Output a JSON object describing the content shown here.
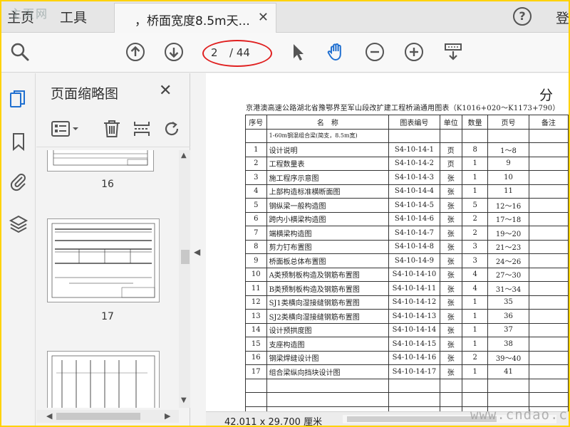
{
  "tabs": {
    "home": "主页",
    "tools": "工具",
    "doc_title": "，桥面宽度8.5m天...",
    "close": "✕",
    "help": "?",
    "login": "登"
  },
  "watermark_top": "主页网",
  "toolbar": {
    "page_current": "2",
    "page_total": "/ 44"
  },
  "thumbnails": {
    "title": "页面缩略图",
    "close": "✕",
    "pages": [
      "16",
      "17"
    ]
  },
  "document": {
    "corner": "分",
    "heading": "京港澳高速公路湖北省豫鄂界至军山段改扩建工程桥涵通用图表（K1016+020～K1173+790）",
    "headers": [
      "序号",
      "名　称",
      "图表编号",
      "单位",
      "数量",
      "页号",
      "备注"
    ],
    "subtitle": "1-60m钢混组合梁(简支，8.5m宽)",
    "rows": [
      {
        "no": "1",
        "name": "设计说明",
        "code": "S4-10-14-1",
        "unit": "页",
        "count": "8",
        "page": "1～8"
      },
      {
        "no": "2",
        "name": "工程数量表",
        "code": "S4-10-14-2",
        "unit": "页",
        "count": "1",
        "page": "9"
      },
      {
        "no": "3",
        "name": "施工程序示意图",
        "code": "S4-10-14-3",
        "unit": "张",
        "count": "1",
        "page": "10"
      },
      {
        "no": "4",
        "name": "上部构造标准横断面图",
        "code": "S4-10-14-4",
        "unit": "张",
        "count": "1",
        "page": "11"
      },
      {
        "no": "5",
        "name": "钢纵梁一般构造图",
        "code": "S4-10-14-5",
        "unit": "张",
        "count": "5",
        "page": "12～16"
      },
      {
        "no": "6",
        "name": "跨内小横梁构造图",
        "code": "S4-10-14-6",
        "unit": "张",
        "count": "2",
        "page": "17～18"
      },
      {
        "no": "7",
        "name": "端横梁构造图",
        "code": "S4-10-14-7",
        "unit": "张",
        "count": "2",
        "page": "19～20"
      },
      {
        "no": "8",
        "name": "剪力钉布置图",
        "code": "S4-10-14-8",
        "unit": "张",
        "count": "3",
        "page": "21～23"
      },
      {
        "no": "9",
        "name": "桥面板总体布置图",
        "code": "S4-10-14-9",
        "unit": "张",
        "count": "3",
        "page": "24～26"
      },
      {
        "no": "10",
        "name": "A类预制板构造及钢筋布置图",
        "code": "S4-10-14-10",
        "unit": "张",
        "count": "4",
        "page": "27～30"
      },
      {
        "no": "11",
        "name": "B类预制板构造及钢筋布置图",
        "code": "S4-10-14-11",
        "unit": "张",
        "count": "4",
        "page": "31～34"
      },
      {
        "no": "12",
        "name": "SJ1类横向湿接缝钢筋布置图",
        "code": "S4-10-14-12",
        "unit": "张",
        "count": "1",
        "page": "35"
      },
      {
        "no": "13",
        "name": "SJ2类横向湿接缝钢筋布置图",
        "code": "S4-10-14-13",
        "unit": "张",
        "count": "1",
        "page": "36"
      },
      {
        "no": "14",
        "name": "设计预拱度图",
        "code": "S4-10-14-14",
        "unit": "张",
        "count": "1",
        "page": "37"
      },
      {
        "no": "15",
        "name": "支座构造图",
        "code": "S4-10-14-15",
        "unit": "张",
        "count": "1",
        "page": "38"
      },
      {
        "no": "16",
        "name": "钢梁焊缝设计图",
        "code": "S4-10-14-16",
        "unit": "张",
        "count": "2",
        "page": "39～40"
      },
      {
        "no": "17",
        "name": "组合梁纵向挡块设计图",
        "code": "S4-10-14-17",
        "unit": "张",
        "count": "1",
        "page": "41"
      }
    ]
  },
  "status": {
    "page_size": "42.011 x 29.700 厘米"
  },
  "watermark_site": "www.cndao.com",
  "colors": {
    "frame": "#ffd200",
    "annotation_ellipse": "#e02020",
    "attach_icon": "#1f6fd0"
  }
}
